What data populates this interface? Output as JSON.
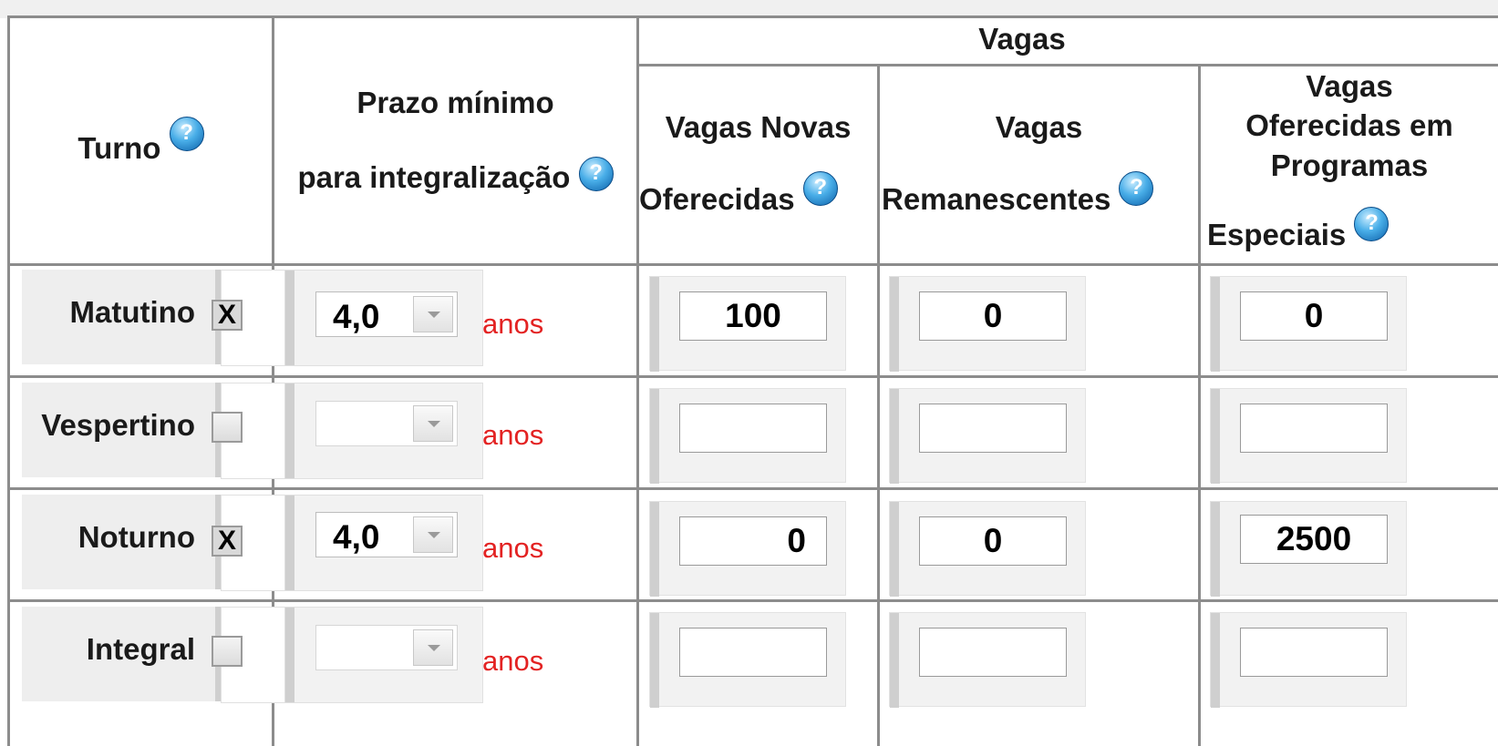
{
  "headers": {
    "turno": "Turno",
    "prazo_line1": "Prazo mínimo",
    "prazo_line2": "para integralização",
    "vagas": "Vagas",
    "novas_line1": "Vagas Novas",
    "novas_line2": "Oferecidas",
    "remanescentes_line1": "Vagas",
    "remanescentes_line2": "Remanescentes",
    "programas_line1": "Vagas",
    "programas_line2": "Oferecidas em",
    "programas_line3": "Programas",
    "programas_line4": "Especiais"
  },
  "help_icon": "question-circle-icon",
  "unit_label_color": "#e32222",
  "rows": [
    {
      "shift": "Matutino",
      "checked": "X",
      "prazo": "4,0",
      "unit": "anos",
      "vagas_novas": "100",
      "vagas_remanescentes": "0",
      "vagas_programas": "0"
    },
    {
      "shift": "Vespertino",
      "checked": "",
      "prazo": "",
      "unit": "anos",
      "vagas_novas": "",
      "vagas_remanescentes": "",
      "vagas_programas": ""
    },
    {
      "shift": "Noturno",
      "checked": "X",
      "prazo": "4,0",
      "unit": "anos",
      "vagas_novas": "0",
      "vagas_remanescentes": "0",
      "vagas_programas": "2500"
    },
    {
      "shift": "Integral",
      "checked": "",
      "prazo": "",
      "unit": "anos",
      "vagas_novas": "",
      "vagas_remanescentes": "",
      "vagas_programas": ""
    }
  ]
}
